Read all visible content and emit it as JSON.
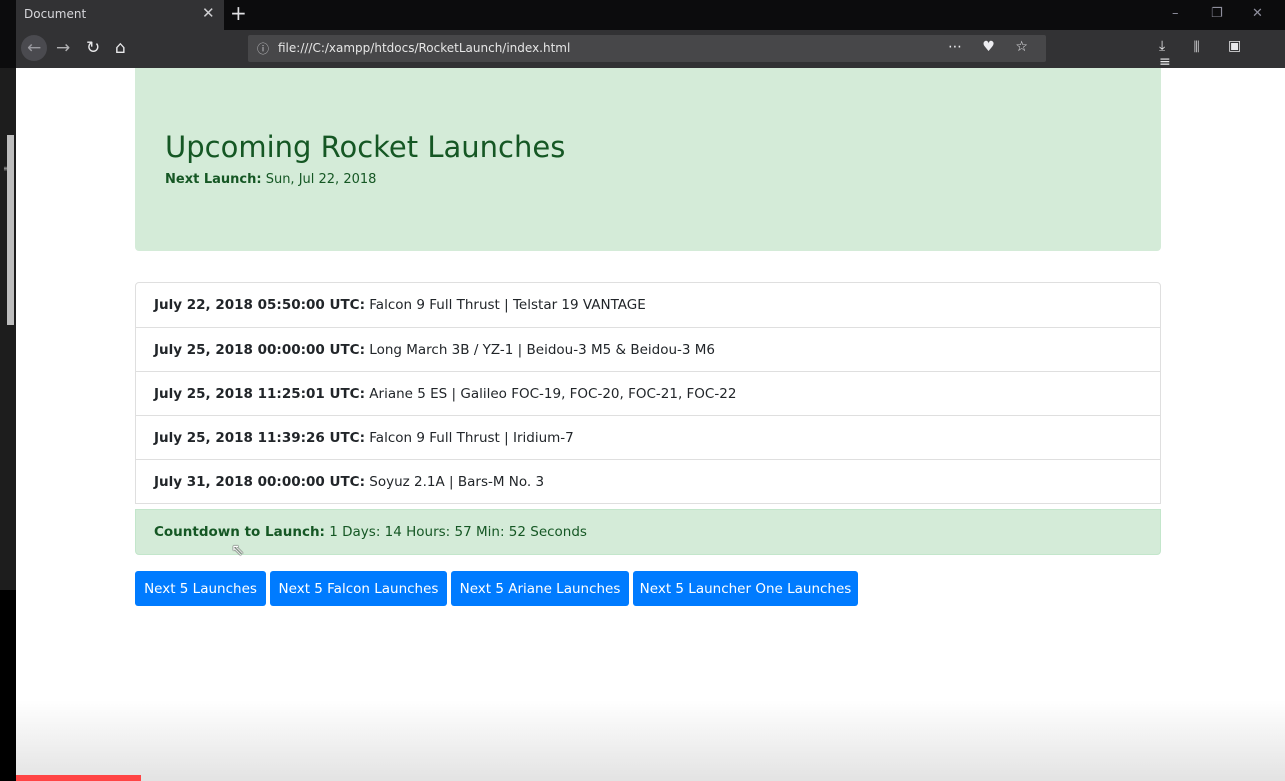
{
  "browser": {
    "tab_title": "Document",
    "tab_close": "✕",
    "new_tab": "+",
    "url": "file:///C:/xampp/htdocs/RocketLaunch/index.html",
    "window_controls": {
      "minimize": "–",
      "restore": "❐",
      "close": "✕"
    },
    "nav": {
      "back": "←",
      "forward": "→",
      "reload": "↻",
      "home": "⌂"
    },
    "url_actions": "⋯ ♥ ☆",
    "toolbar_right": "⤓ ⫴ ▣ ≡"
  },
  "header": {
    "title": "Upcoming Rocket Launches",
    "next_label": "Next Launch:",
    "next_value": "Sun, Jul 22, 2018"
  },
  "launches": [
    {
      "time": "July 22, 2018 05:50:00 UTC:",
      "detail": "Falcon 9 Full Thrust | Telstar 19 VANTAGE"
    },
    {
      "time": "July 25, 2018 00:00:00 UTC:",
      "detail": "Long March 3B / YZ-1 | Beidou-3 M5 & Beidou-3 M6"
    },
    {
      "time": "July 25, 2018 11:25:01 UTC:",
      "detail": "Ariane 5 ES | Galileo FOC-19, FOC-20, FOC-21, FOC-22"
    },
    {
      "time": "July 25, 2018 11:39:26 UTC:",
      "detail": "Falcon 9 Full Thrust | Iridium-7"
    },
    {
      "time": "July 31, 2018 00:00:00 UTC:",
      "detail": "Soyuz 2.1A | Bars-M No. 3"
    }
  ],
  "countdown": {
    "label": "Countdown to Launch:",
    "value": "1 Days: 14 Hours: 57 Min: 52 Seconds"
  },
  "buttons": {
    "next5": "Next 5 Launches",
    "falcon": "Next 5 Falcon Launches",
    "ariane": "Next 5 Ariane Launches",
    "launcher_one": "Next 5 Launcher One Launches"
  },
  "colors": {
    "accent": "#007bff",
    "success_bg": "#d4ebd8",
    "success_text": "#155724"
  }
}
